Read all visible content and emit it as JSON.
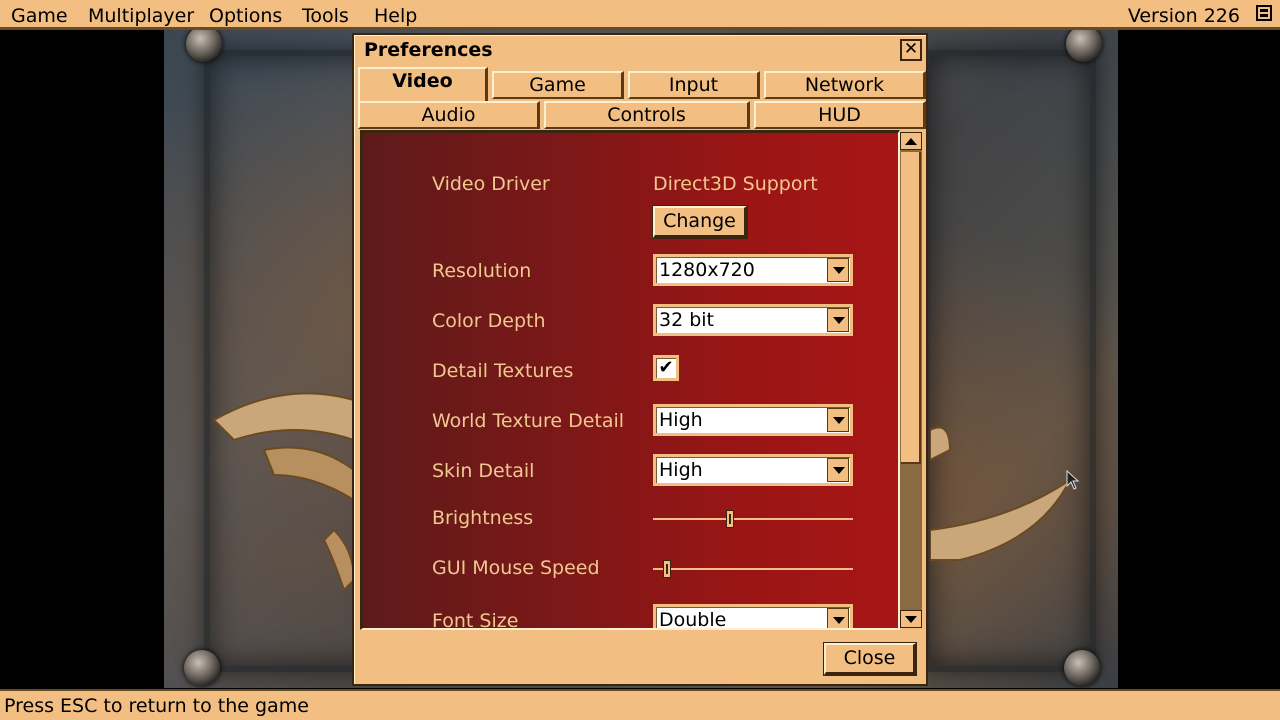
{
  "menubar": {
    "items": [
      "Game",
      "Multiplayer",
      "Options",
      "Tools",
      "Help"
    ],
    "version": "Version 226",
    "icon": "window-restore-icon"
  },
  "window": {
    "title": "Preferences",
    "close_glyph": "✕",
    "tabs_row1": [
      "Video",
      "Game",
      "Input",
      "Network"
    ],
    "tabs_row2": [
      "Audio",
      "Controls",
      "HUD"
    ],
    "active_tab": "Video",
    "video": {
      "video_driver_label": "Video Driver",
      "video_driver_value": "Direct3D Support",
      "change_button": "Change",
      "resolution_label": "Resolution",
      "resolution_value": "1280x720",
      "color_depth_label": "Color Depth",
      "color_depth_value": "32 bit",
      "detail_textures_label": "Detail Textures",
      "detail_textures_checked": true,
      "check_glyph": "✔",
      "world_texture_label": "World Texture Detail",
      "world_texture_value": "High",
      "skin_detail_label": "Skin Detail",
      "skin_detail_value": "High",
      "brightness_label": "Brightness",
      "brightness_value": 0.38,
      "gui_mouse_speed_label": "GUI Mouse Speed",
      "gui_mouse_speed_value": 0.05,
      "font_size_label": "Font Size",
      "font_size_value": "Double"
    },
    "close_button": "Close"
  },
  "statusbar": {
    "text": "Press ESC to return to the game"
  },
  "colors": {
    "accent": "#f2be82",
    "panel_dark": "#5e1a1a",
    "panel_light": "#a81616",
    "label": "#f0c890"
  }
}
